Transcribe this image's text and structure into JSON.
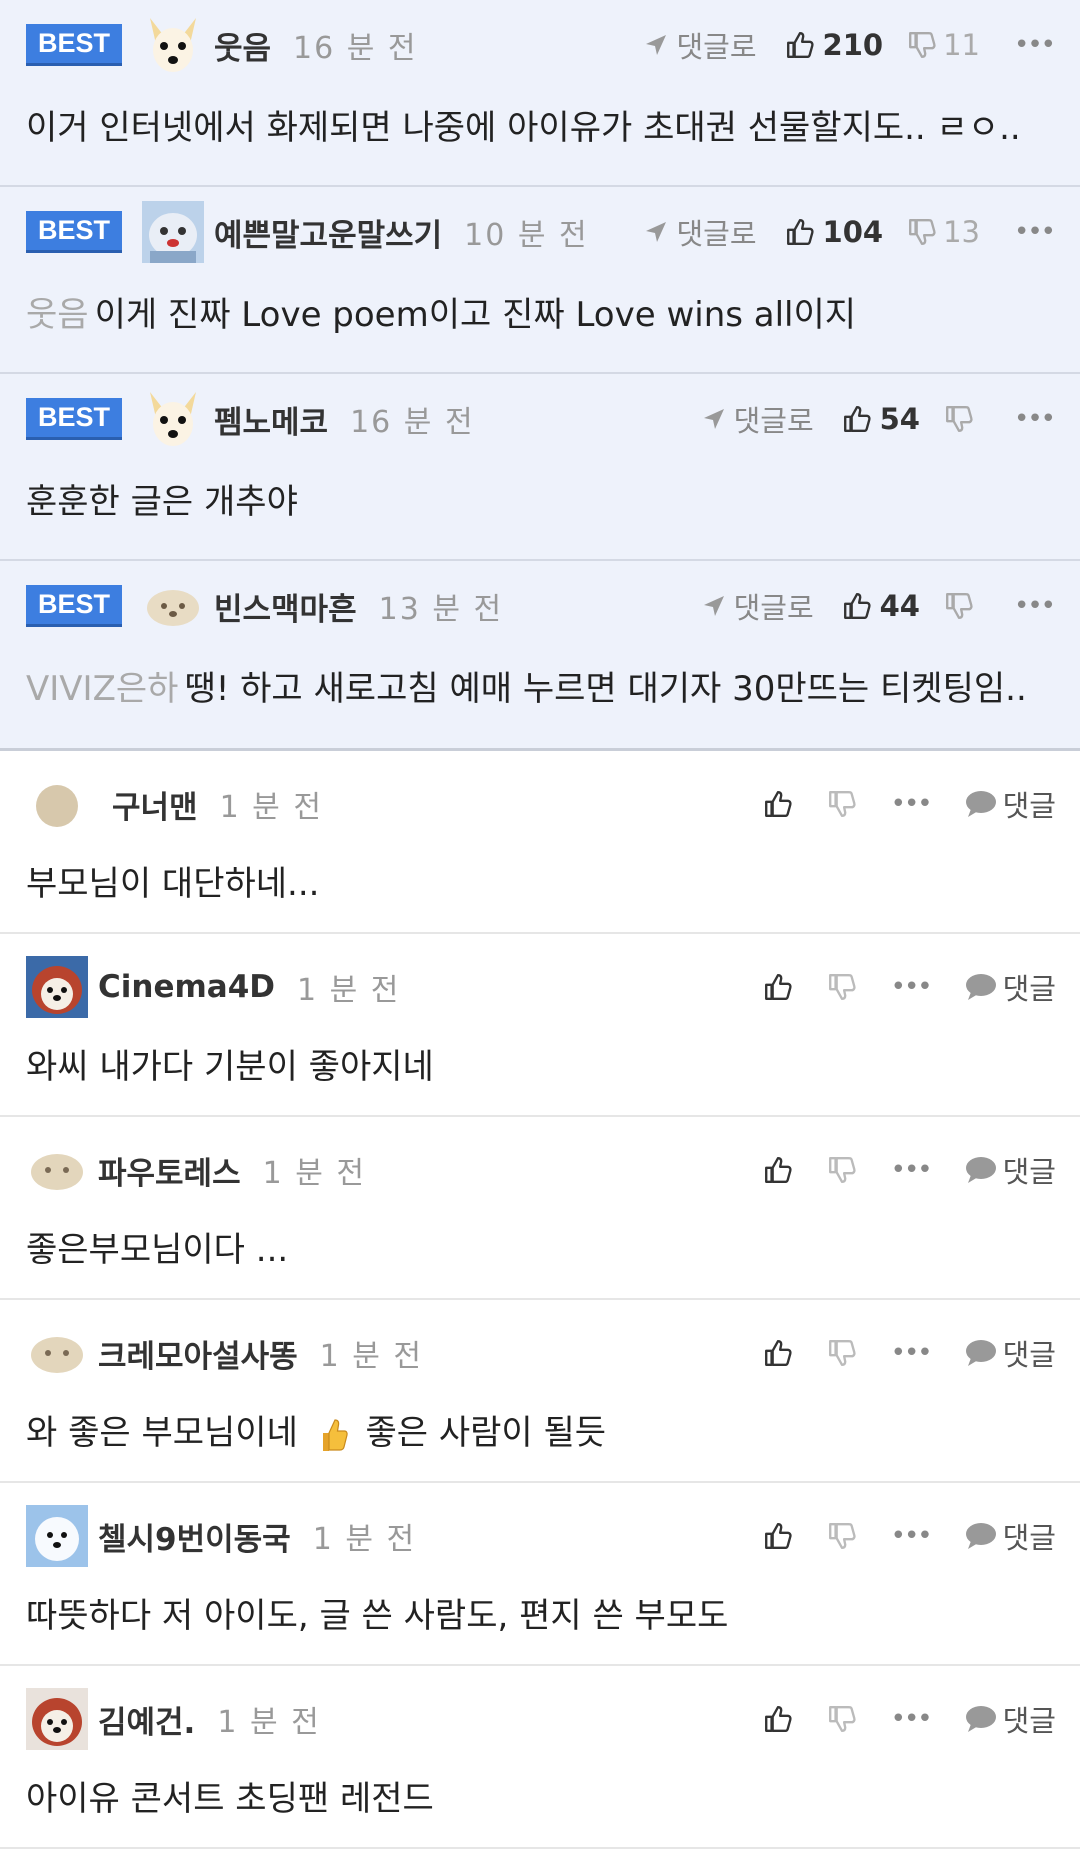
{
  "best_comments": [
    {
      "badge": "BEST",
      "avatar": "puppy-white-icon",
      "nickname": "웃음",
      "time": "16 분 전",
      "reply_label": "댓글로",
      "likes": "210",
      "dislikes": "11",
      "mention": "",
      "text": "이거 인터넷에서 화제되면 나중에 아이유가 초대권 선물할지도.. ㄹㅇ.."
    },
    {
      "badge": "BEST",
      "avatar": "toy-bear-icon",
      "nickname": "예쁜말고운말쓰기",
      "time": "10 분 전",
      "reply_label": "댓글로",
      "likes": "104",
      "dislikes": "13",
      "mention": "웃음",
      "text": "이게 진짜 Love poem이고 진짜 Love wins all이지"
    },
    {
      "badge": "BEST",
      "avatar": "puppy-white-icon",
      "nickname": "펨노메코",
      "time": "16 분 전",
      "reply_label": "댓글로",
      "likes": "54",
      "dislikes": "",
      "mention": "",
      "text": "훈훈한 글은 개추야"
    },
    {
      "badge": "BEST",
      "avatar": "puppy-beige-icon",
      "nickname": "빈스맥마흔",
      "time": "13 분 전",
      "reply_label": "댓글로",
      "likes": "44",
      "dislikes": "",
      "mention": "VIVIZ은하",
      "text": "땡! 하고 새로고침 예매 누르면 대기자 30만뜨는 티켓팅임.."
    }
  ],
  "comments": [
    {
      "avatar": "default-circle-icon",
      "nickname": "구너맨",
      "time": "1 분 전",
      "reply_label": "댓글",
      "text": "부모님이 대단하네..."
    },
    {
      "avatar": "dog-red-icon",
      "nickname": "Cinema4D",
      "time": "1 분 전",
      "reply_label": "댓글",
      "text": "와씨 내가다 기분이 좋아지네"
    },
    {
      "avatar": "puppy-beige-icon",
      "nickname": "파우토레스",
      "time": "1 분 전",
      "reply_label": "댓글",
      "text": "좋은부모님이다 ..."
    },
    {
      "avatar": "puppy-beige-icon",
      "nickname": "크레모아설사똥",
      "time": "1 분 전",
      "reply_label": "댓글",
      "text_before": "와 좋은 부모님이네",
      "emoji": "thumbs-up-emoji",
      "text_after": "좋은 사람이 될듯"
    },
    {
      "avatar": "dog-white-blue-icon",
      "nickname": "첼시9번이동국",
      "time": "1 분 전",
      "reply_label": "댓글",
      "text": "따뜻하다 저 아이도, 글 쓴 사람도, 편지 쓴 부모도"
    },
    {
      "avatar": "dog-red-icon",
      "nickname": "김예건.",
      "time": "1 분 전",
      "reply_label": "댓글",
      "text": "아이유 콘서트 초딩팬 레전드"
    }
  ],
  "colors": {
    "best_bg": "#eef2fb",
    "badge": "#3d7ee0",
    "muted": "#999999"
  }
}
